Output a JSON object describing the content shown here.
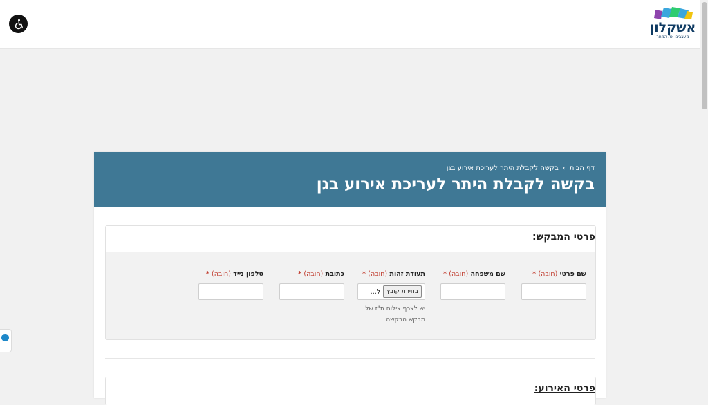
{
  "header": {
    "logo_text": "אשקלון",
    "logo_sub": "מעצבים את המחר"
  },
  "breadcrumb": {
    "home": "דף הבית",
    "separator": "›",
    "current": "בקשה לקבלת היתר לעריכת אירוע בגן"
  },
  "page_title": "בקשה לקבלת היתר לעריכת אירוע בגן",
  "sections": {
    "requester": {
      "title": "פרטי המבקש:",
      "fields": {
        "first_name": {
          "label": "שם פרטי",
          "note": "(חובה)",
          "star": "*",
          "value": ""
        },
        "last_name": {
          "label": "שם משפחה",
          "note": "(חובה)",
          "star": "*",
          "value": ""
        },
        "id_card": {
          "label": "תעודת זהות",
          "note": "(חובה)",
          "star": "*",
          "button": "בחירת קובץ",
          "file_name": "ל...",
          "help": "יש לצרף צילום ת\"ז של מבקש הבקשה"
        },
        "address": {
          "label": "כתובת",
          "note": "(חובה)",
          "star": "*",
          "value": ""
        },
        "mobile": {
          "label": "טלפון נייד",
          "note": "(חובה)",
          "star": "*",
          "value": ""
        }
      }
    },
    "event": {
      "title": "פרטי האירוע:"
    }
  },
  "colors": {
    "banner": "#3f7895",
    "required": "#c0392b",
    "logo": "#0f3b63"
  },
  "icons": {
    "accessibility": "wheelchair-icon",
    "side_widget": "teamviewer-icon"
  }
}
